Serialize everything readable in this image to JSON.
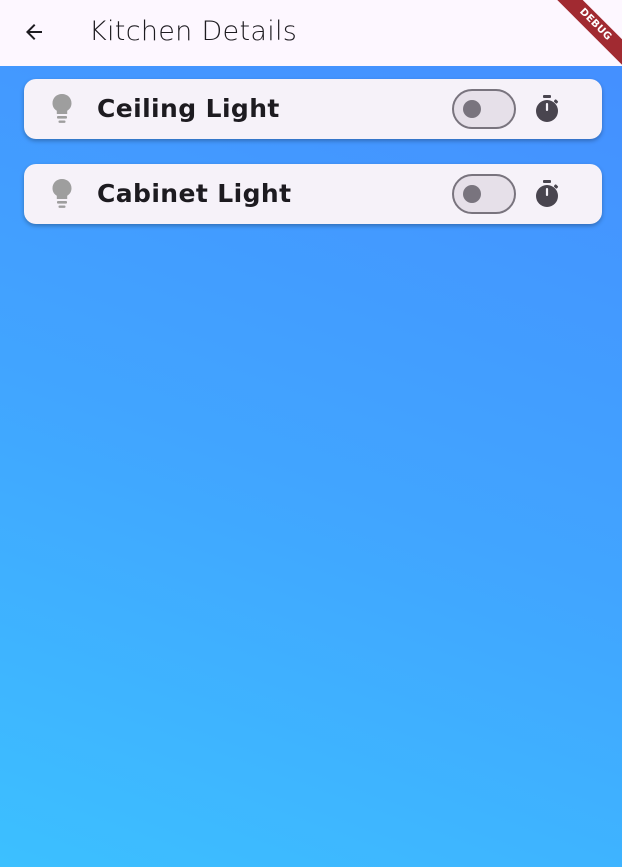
{
  "app_bar": {
    "title": "Kitchen Details",
    "back_icon": "arrow-back-icon",
    "background": "#fdf7ff"
  },
  "debug_banner": {
    "label": "DEBUG",
    "color": "#a12a31"
  },
  "background_gradient": [
    "#458dff",
    "#3cc0ff"
  ],
  "lights": [
    {
      "label": "Ceiling Light",
      "icon": "lightbulb-icon",
      "switch_on": false,
      "timer_icon": "timer-icon"
    },
    {
      "label": "Cabinet Light",
      "icon": "lightbulb-icon",
      "switch_on": false,
      "timer_icon": "timer-icon"
    }
  ],
  "colors": {
    "card_background": "#f6f2f9",
    "text": "#1d1b20",
    "bulb_off": "#9e9e9e",
    "switch_outline": "#79747e",
    "switch_track": "#e6e0e9",
    "timer_icon": "#49454f"
  }
}
